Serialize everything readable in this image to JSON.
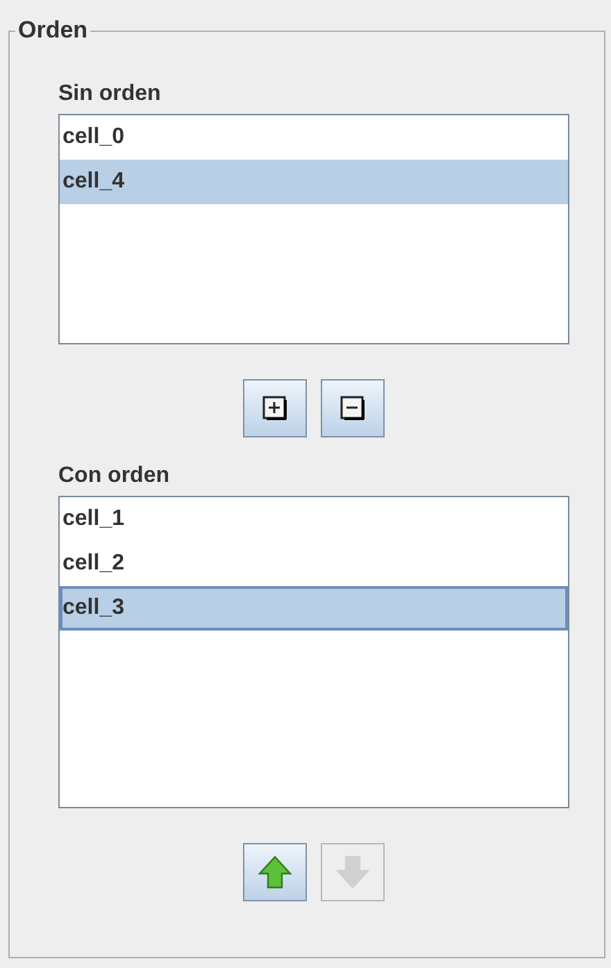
{
  "group": {
    "title": "Orden",
    "unordered": {
      "label": "Sin orden",
      "items": [
        {
          "text": "cell_0",
          "selected": false
        },
        {
          "text": "cell_4",
          "selected": true
        }
      ],
      "buttons": [
        {
          "kind": "add",
          "disabled": false
        },
        {
          "kind": "remove",
          "disabled": false
        }
      ]
    },
    "ordered": {
      "label": "Con orden",
      "items": [
        {
          "text": "cell_1",
          "selected": false,
          "focused": false
        },
        {
          "text": "cell_2",
          "selected": false,
          "focused": false
        },
        {
          "text": "cell_3",
          "selected": true,
          "focused": true
        }
      ],
      "buttons": [
        {
          "kind": "up",
          "disabled": false
        },
        {
          "kind": "down",
          "disabled": true
        }
      ]
    }
  }
}
